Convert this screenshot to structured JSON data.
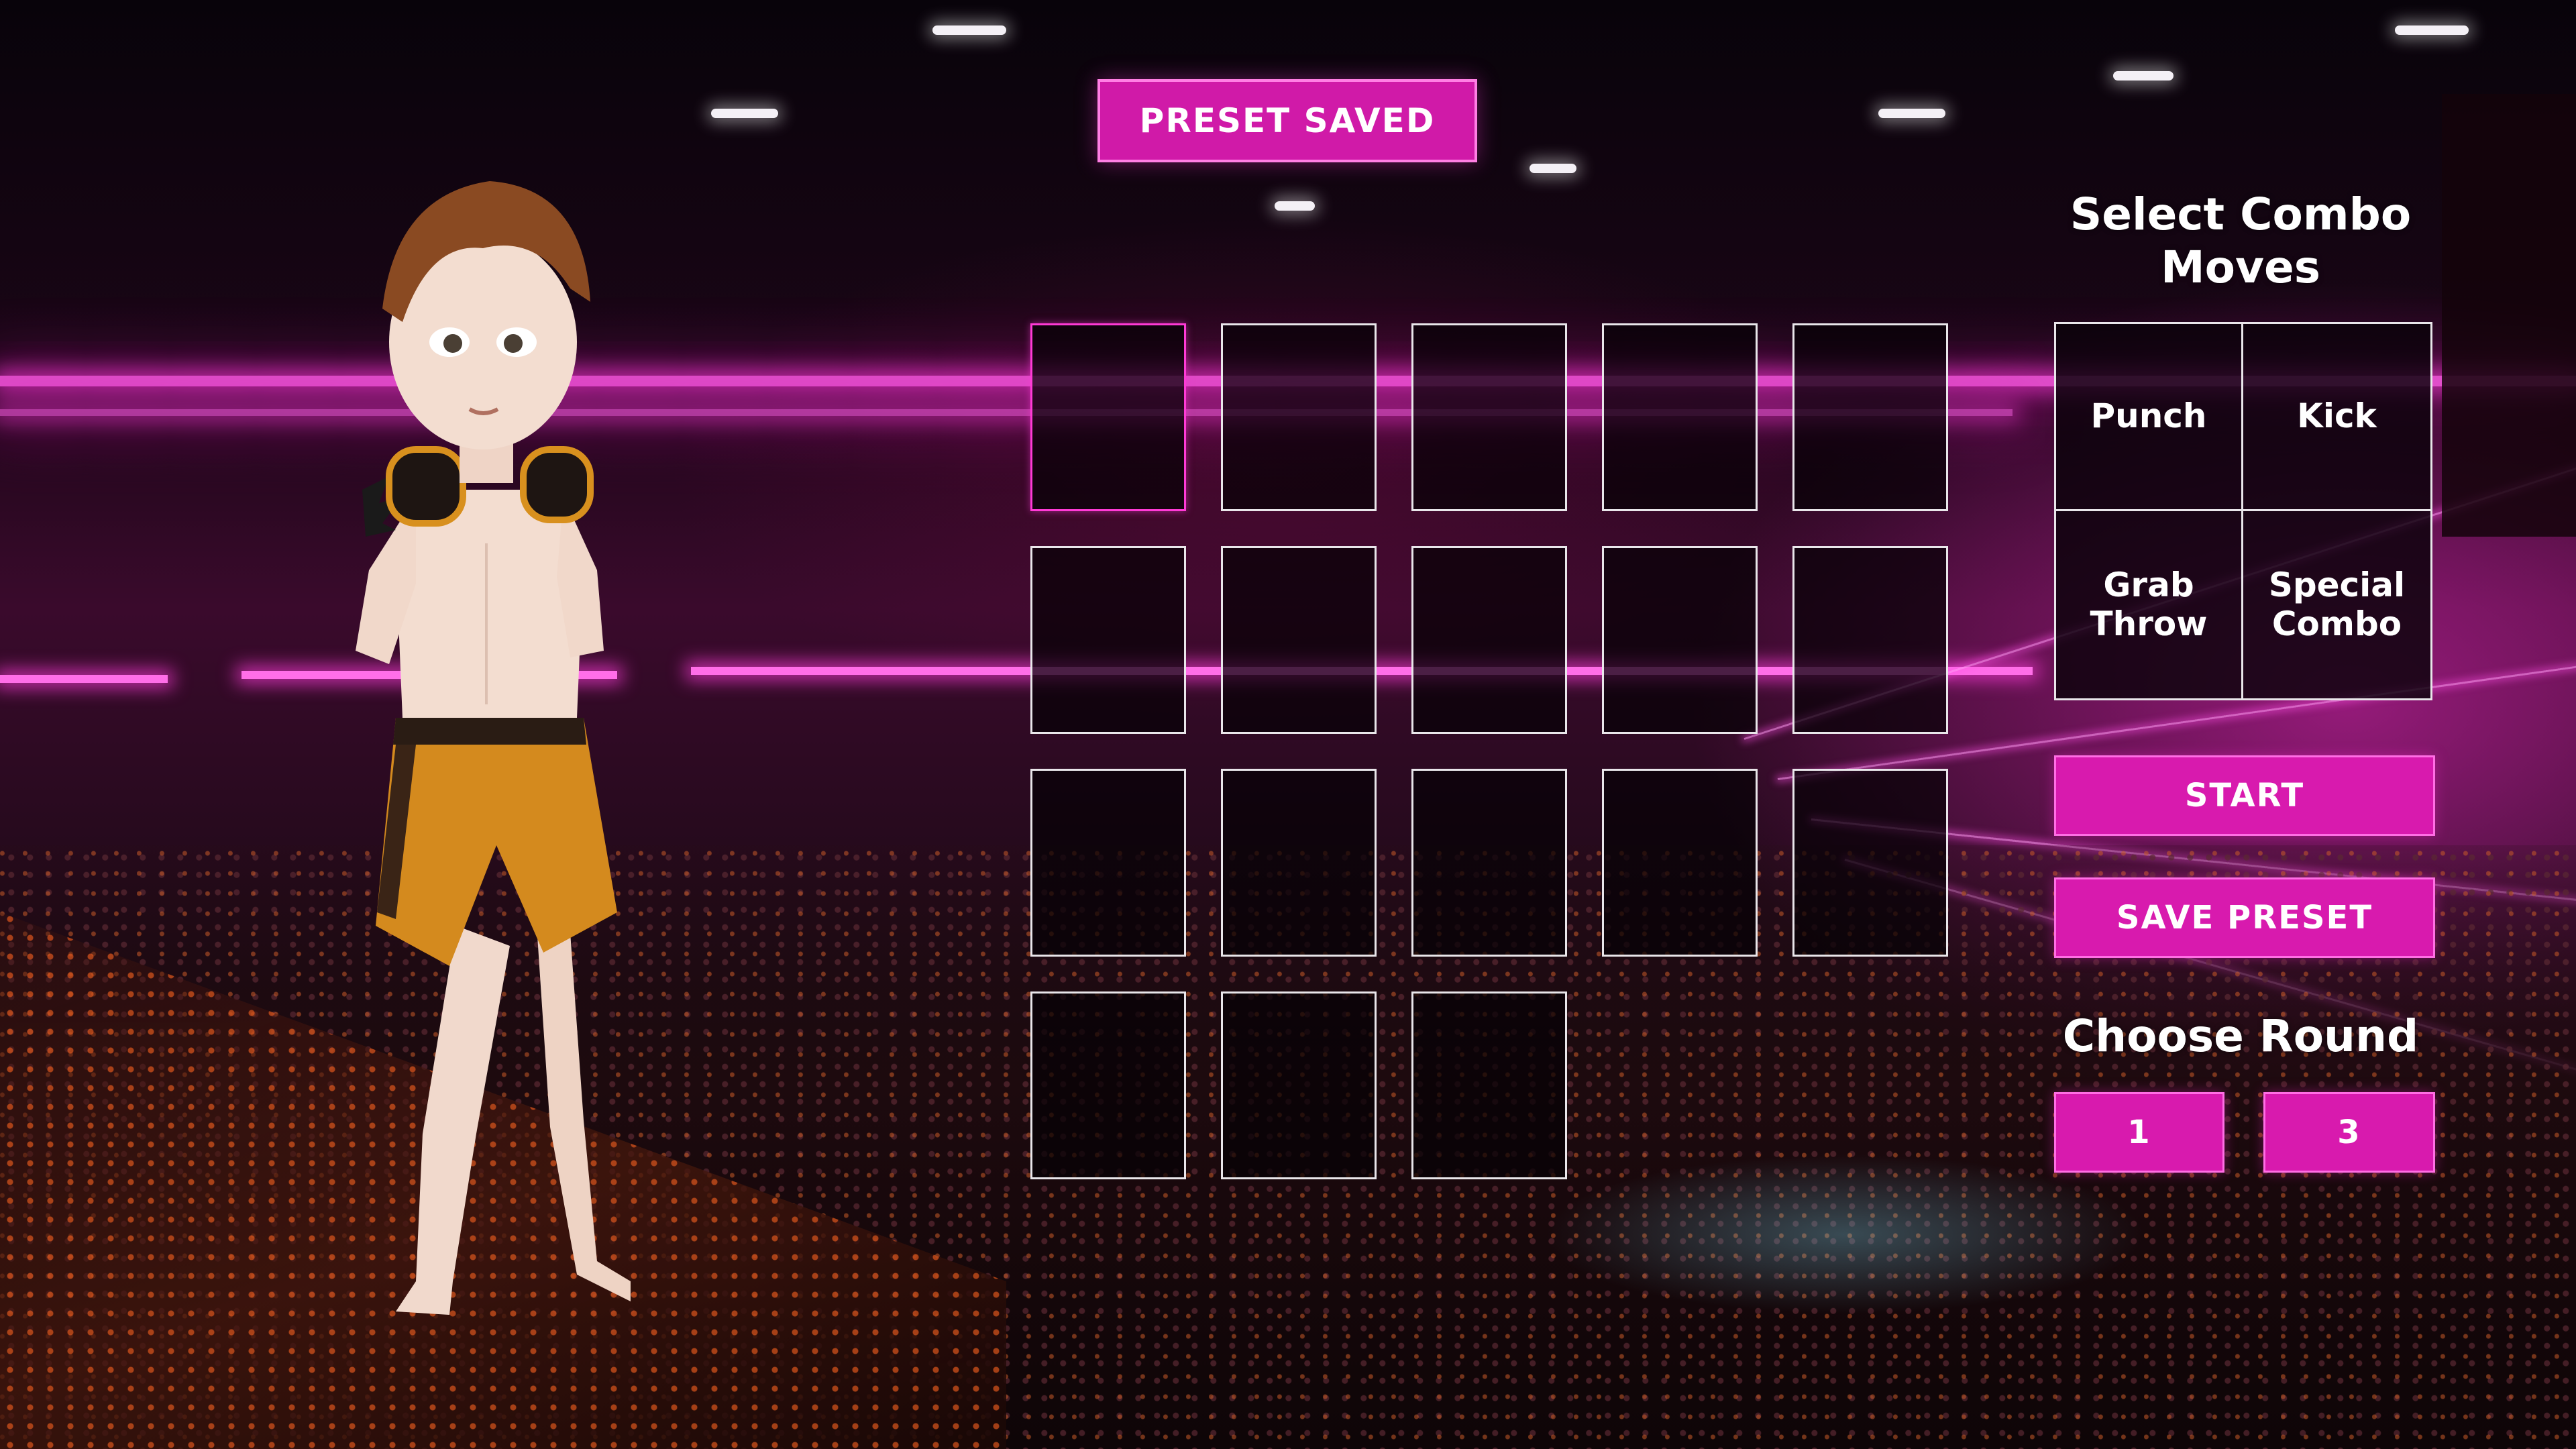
{
  "toast": {
    "text": "PRESET SAVED"
  },
  "combo_slots": {
    "count": 18,
    "columns": 5,
    "active_index": 0
  },
  "moves_panel": {
    "title": "Select Combo\nMoves",
    "moves": [
      "Punch",
      "Kick",
      "Grab\nThrow",
      "Special\nCombo"
    ]
  },
  "actions": {
    "start_label": "START",
    "save_preset_label": "SAVE PRESET"
  },
  "rounds": {
    "title": "Choose Round",
    "options": [
      "1",
      "3"
    ]
  },
  "colors": {
    "accent": "#d81aae",
    "accent_border": "#ff6ee4",
    "slot_border": "#e9e6ea",
    "active_slot": "#ff3ad6"
  }
}
